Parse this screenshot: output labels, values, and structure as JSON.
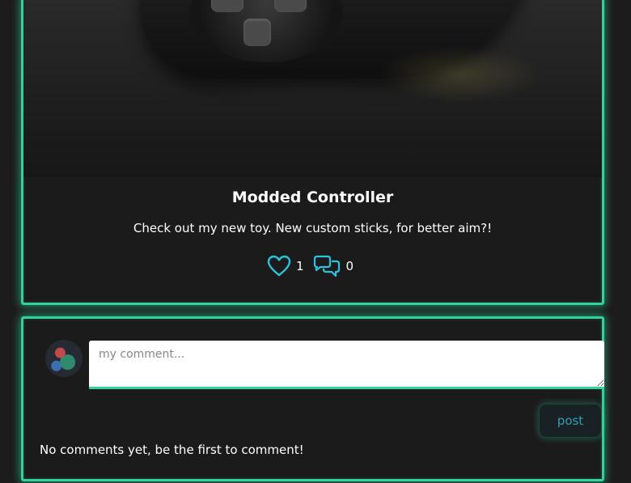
{
  "colors": {
    "accent": "#2fd39b",
    "icon": "#27c4dd",
    "background": "#1c1c1c",
    "card": "#1b1b1b",
    "button_text": "#2aa3b5"
  },
  "post": {
    "image_alt": "Modded controller photo",
    "title": "Modded Controller",
    "description": "Check out my new toy. New custom sticks, for better aim?!",
    "likes": "1",
    "comments": "0",
    "like_icon": "heart-icon",
    "comment_icon": "comment-bubbles-icon"
  },
  "comment_form": {
    "placeholder": "my comment...",
    "value": "",
    "post_label": "post"
  },
  "comments": {
    "empty_text": "No comments yet, be the first to comment!"
  }
}
